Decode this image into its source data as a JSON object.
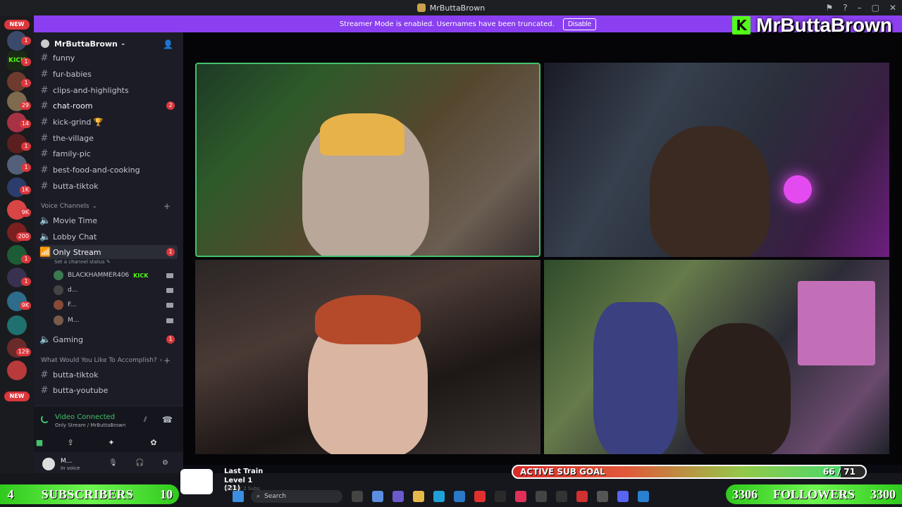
{
  "window": {
    "title": "MrButtaBrown"
  },
  "banner": {
    "text": "Streamer Mode is enabled. Usernames have been truncated.",
    "disable_label": "Disable"
  },
  "brand": {
    "logo_letter": "K",
    "name": "MrButtaBrown"
  },
  "rail": {
    "top_pill": "NEW",
    "bottom_pill": "NEW",
    "badges": [
      "1",
      "1",
      "1",
      "29",
      "14",
      "1",
      "1",
      "1K",
      "9K",
      "200",
      "1",
      "1",
      "9K",
      "129"
    ]
  },
  "server": {
    "name": "MrButtaBrown"
  },
  "channels": [
    {
      "name": "funny"
    },
    {
      "name": "fur-babies"
    },
    {
      "name": "clips-and-highlights"
    },
    {
      "name": "chat-room",
      "badge": "2"
    },
    {
      "name": "kick-grind 🏆"
    },
    {
      "name": "the-village"
    },
    {
      "name": "family-pic"
    },
    {
      "name": "best-food-and-cooking"
    },
    {
      "name": "butta-tiktok"
    }
  ],
  "voice_category": {
    "label": "Voice Channels"
  },
  "voice_channels": [
    {
      "name": "Movie Time"
    },
    {
      "name": "Lobby Chat"
    },
    {
      "name": "Only Stream",
      "badge": "1",
      "status_placeholder": "Set a channel status"
    }
  ],
  "voice_users": [
    {
      "name": "BLACKHAMMER406",
      "tag": "KICK"
    },
    {
      "name": "d..."
    },
    {
      "name": "F..."
    },
    {
      "name": "M..."
    }
  ],
  "gaming_channel": {
    "name": "Gaming",
    "badge": "1"
  },
  "category2": {
    "label": "What Would You Like To Accomplish?"
  },
  "channels2": [
    {
      "name": "butta-tiktok"
    },
    {
      "name": "butta-youtube"
    }
  ],
  "voice_panel": {
    "title": "Video Connected",
    "subtitle": "Only Stream / MrButtaBrown"
  },
  "user_panel": {
    "name": "M...",
    "status": "In voice"
  },
  "overlay": {
    "subs": {
      "current": "4",
      "label": "SUBSCRIBERS",
      "goal": "10"
    },
    "followers": {
      "current": "3306",
      "label": "FOLLOWERS",
      "goal": "3300"
    },
    "music": {
      "track": "Last Train",
      "level": "Level 1  (21)",
      "hits": "Hits 1 / 2 Subs"
    },
    "sub_goal": {
      "label": "ACTIVE SUB GOAL",
      "count": "66 / 71",
      "progress": 0.93
    }
  },
  "taskbar": {
    "search_placeholder": "Search"
  },
  "colors": {
    "accent": "#8a3ff0",
    "kick_green": "#53fc18",
    "badge_red": "#da373c",
    "voice_green": "#43c26c"
  }
}
